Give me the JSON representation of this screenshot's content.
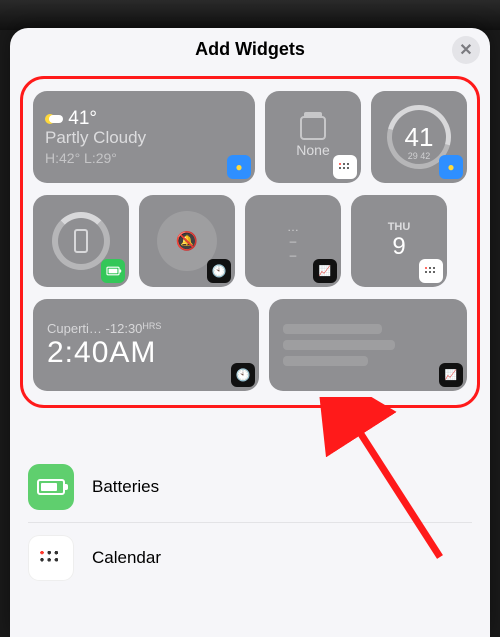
{
  "header": {
    "title": "Add Widgets",
    "close": "✕"
  },
  "weather_wide": {
    "temp": "41°",
    "condition": "Partly Cloudy",
    "hilo": "H:42° L:29°"
  },
  "calendar_empty": {
    "label": "None"
  },
  "weather_gauge": {
    "value": "41",
    "sub": "29 42"
  },
  "fitness": {
    "dots": "…",
    "dash1": "–",
    "dash2": "–"
  },
  "calendar_day": {
    "dow": "THU",
    "day": "9"
  },
  "clock_wide": {
    "city": "Cuperti…",
    "offset": "-12:30",
    "hrs": "HRS",
    "time": "2:40AM"
  },
  "app_list": [
    {
      "key": "batteries",
      "label": "Batteries"
    },
    {
      "key": "calendar",
      "label": "Calendar"
    }
  ],
  "icons": {
    "bell": "🔕",
    "clock": "🕙",
    "chart": "📈",
    "sun": "☀"
  }
}
